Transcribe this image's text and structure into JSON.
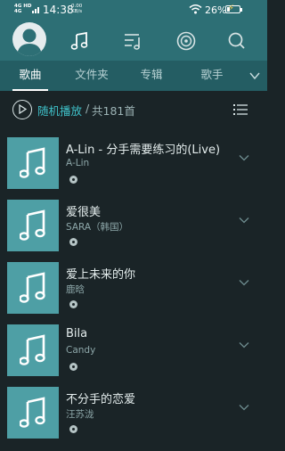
{
  "status_bar": {
    "network_line1": "4G HD",
    "network_line2": "4G",
    "time": "14:38",
    "speed_value": "0.00",
    "speed_unit": "KB/s",
    "battery_percent": "26%",
    "battery_level": 0.26
  },
  "top_nav": {
    "icons": [
      "avatar",
      "music-note-icon",
      "playlist-icon",
      "radio-disc-icon",
      "search-icon"
    ]
  },
  "tabs": [
    {
      "label": "歌曲",
      "active": true
    },
    {
      "label": "文件夹",
      "active": false
    },
    {
      "label": "专辑",
      "active": false
    },
    {
      "label": "歌手",
      "active": false
    }
  ],
  "play_all": {
    "label": "随机播放",
    "separator": "/",
    "count_text": "共181首"
  },
  "songs": [
    {
      "title": "A-Lin - 分手需要练习的(Live)",
      "artist": "A-Lin"
    },
    {
      "title": "爱很美",
      "artist": "SARA（韩国）"
    },
    {
      "title": "爱上未来的你",
      "artist": "鹿晗"
    },
    {
      "title": "Bila",
      "artist": "Candy"
    },
    {
      "title": "不分手的恋爱",
      "artist": "汪苏泷"
    }
  ],
  "colors": {
    "header_teal": "#2d6f75",
    "tab_bar": "#245d63",
    "background": "#1a2427",
    "accent": "#3fc1c9",
    "cover": "#4e9fa5"
  }
}
